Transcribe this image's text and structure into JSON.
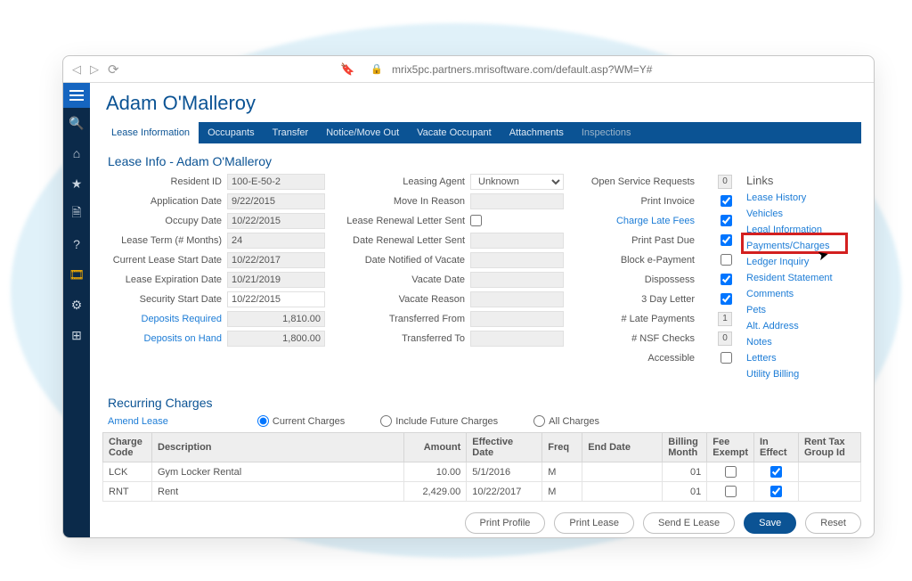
{
  "browser": {
    "url": "mrix5pc.partners.mrisoftware.com/default.asp?WM=Y#"
  },
  "page": {
    "title": "Adam O'Malleroy"
  },
  "tabs": [
    "Lease Information",
    "Occupants",
    "Transfer",
    "Notice/Move Out",
    "Vacate Occupant",
    "Attachments",
    "Inspections"
  ],
  "leaseInfo": {
    "heading": "Lease Info - Adam O'Malleroy",
    "colA": [
      {
        "label": "Resident ID",
        "value": "100-E-50-2"
      },
      {
        "label": "Application Date",
        "value": "9/22/2015"
      },
      {
        "label": "Occupy Date",
        "value": "10/22/2015"
      },
      {
        "label": "Lease Term (# Months)",
        "value": "24"
      },
      {
        "label": "Current Lease Start Date",
        "value": "10/22/2017"
      },
      {
        "label": "Lease Expiration Date",
        "value": "10/21/2019"
      },
      {
        "label": "Security Start Date",
        "value": "10/22/2015"
      },
      {
        "label": "Deposits Required",
        "value": "1,810.00",
        "link": true,
        "ro": true
      },
      {
        "label": "Deposits on Hand",
        "value": "1,800.00",
        "link": true,
        "ro": true
      }
    ],
    "colB": [
      {
        "label": "Leasing Agent",
        "select": "Unknown"
      },
      {
        "label": "Move In Reason",
        "value": ""
      },
      {
        "label": "Lease Renewal Letter Sent",
        "check": false
      },
      {
        "label": "Date Renewal Letter Sent",
        "value": ""
      },
      {
        "label": "Date Notified of Vacate",
        "value": ""
      },
      {
        "label": "Vacate Date",
        "value": ""
      },
      {
        "label": "Vacate Reason",
        "value": ""
      },
      {
        "label": "Transferred From",
        "value": ""
      },
      {
        "label": "Transferred To",
        "value": ""
      }
    ],
    "colC": [
      {
        "label": "Open Service Requests",
        "num": "0"
      },
      {
        "label": "Print Invoice",
        "check": true
      },
      {
        "label": "Charge Late Fees",
        "check": true,
        "link": true
      },
      {
        "label": "Print Past Due",
        "check": true
      },
      {
        "label": "Block e-Payment",
        "check": false
      },
      {
        "label": "Dispossess",
        "check": true
      },
      {
        "label": "3 Day Letter",
        "check": true
      },
      {
        "label": "# Late Payments",
        "num": "1"
      },
      {
        "label": "# NSF Checks",
        "num": "0"
      },
      {
        "label": "Accessible",
        "check": false
      }
    ]
  },
  "links": {
    "title": "Links",
    "items": [
      "Lease History",
      "Vehicles",
      "Legal Information",
      "Payments/Charges",
      "Ledger Inquiry",
      "Resident Statement",
      "Comments",
      "Pets",
      "Alt. Address",
      "Notes",
      "Letters",
      "Utility Billing"
    ]
  },
  "recurring": {
    "title": "Recurring Charges",
    "amend": "Amend Lease",
    "radios": [
      "Current Charges",
      "Include Future Charges",
      "All Charges"
    ],
    "headers": [
      "Charge Code",
      "Description",
      "Amount",
      "Effective Date",
      "Freq",
      "End Date",
      "Billing Month",
      "Fee Exempt",
      "In Effect",
      "Rent Tax Group Id"
    ],
    "rows": [
      {
        "code": "LCK",
        "desc": "Gym Locker Rental",
        "amount": "10.00",
        "eff": "5/1/2016",
        "freq": "M",
        "end": "",
        "bill": "01",
        "feeExempt": false,
        "inEffect": true,
        "rtg": ""
      },
      {
        "code": "RNT",
        "desc": "Rent",
        "amount": "2,429.00",
        "eff": "10/22/2017",
        "freq": "M",
        "end": "",
        "bill": "01",
        "feeExempt": false,
        "inEffect": true,
        "rtg": ""
      }
    ]
  },
  "buttons": [
    "Print Profile",
    "Print Lease",
    "Send E Lease",
    "Save",
    "Reset"
  ]
}
